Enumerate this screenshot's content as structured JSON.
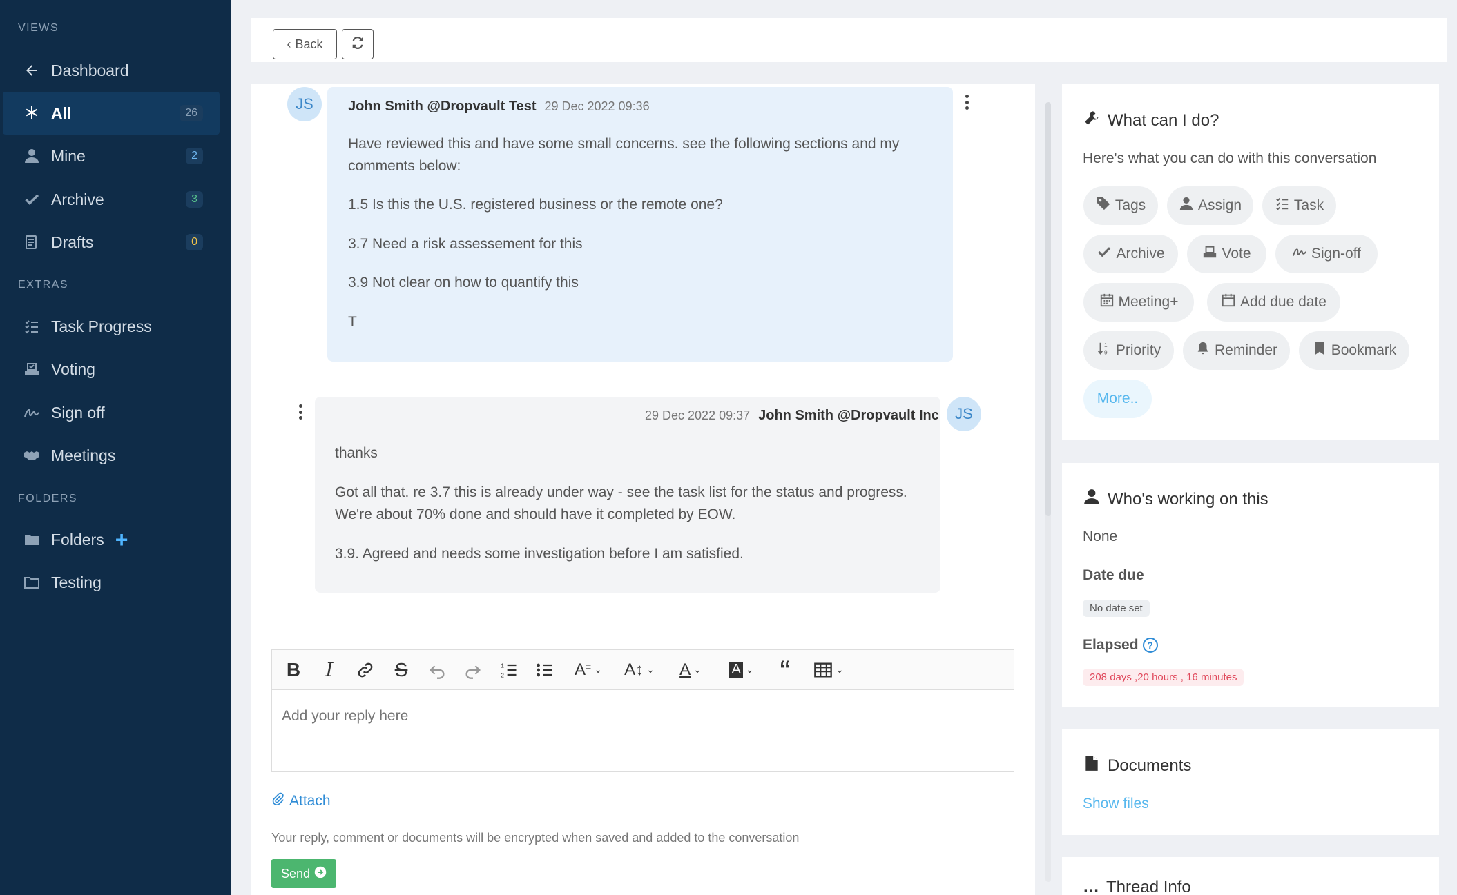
{
  "sidebar": {
    "views_heading": "VIEWS",
    "extras_heading": "EXTRAS",
    "folders_heading": "FOLDERS",
    "views": [
      {
        "label": "Dashboard",
        "icon": "arrow-left-icon"
      },
      {
        "label": "All",
        "icon": "asterisk-icon",
        "count": "26"
      },
      {
        "label": "Mine",
        "icon": "user-icon",
        "count": "2"
      },
      {
        "label": "Archive",
        "icon": "check-icon",
        "count": "3"
      },
      {
        "label": "Drafts",
        "icon": "drafts-icon",
        "count": "0"
      }
    ],
    "extras": [
      {
        "label": "Task Progress",
        "icon": "tasks-icon"
      },
      {
        "label": "Voting",
        "icon": "vote-icon"
      },
      {
        "label": "Sign off",
        "icon": "signature-icon"
      },
      {
        "label": "Meetings",
        "icon": "handshake-icon"
      }
    ],
    "folders": [
      {
        "label": "Folders",
        "icon": "folder-icon"
      },
      {
        "label": "Testing",
        "icon": "folder-outline-icon"
      }
    ]
  },
  "topbar": {
    "back_label": "Back"
  },
  "messages": [
    {
      "avatar": "JS",
      "author": "John Smith @Dropvault Test",
      "time": "29 Dec 2022 09:36",
      "paragraphs": [
        "Have reviewed this and have some small concerns. see the following sections and my",
        "comments below:",
        "1.5 Is this the U.S. registered business or the remote one?",
        "3.7 Need a risk assessement for this",
        "3.9 Not clear on how to quantify this",
        "T"
      ]
    },
    {
      "avatar": "JS",
      "author": "John Smith @Dropvault Inc",
      "time": "29 Dec 2022 09:37",
      "paragraphs": [
        "thanks",
        "Got all that. re 3.7 this is already under way - see the task list for the status and progress.",
        "We're about 70% done and should have it completed by EOW.",
        "3.9. Agreed and needs some investigation before I am satisfied."
      ]
    }
  ],
  "editor": {
    "placeholder": "Add your reply here",
    "attach_label": "Attach",
    "note": "Your reply, comment or documents will be encrypted when saved and added to the conversation",
    "send_label": "Send"
  },
  "actions_card": {
    "title": "What can I do?",
    "subtitle": "Here's what you can do with this conversation",
    "actions": [
      "Tags",
      "Assign",
      "Task",
      "Archive",
      "Vote",
      "Sign-off",
      "Meeting+",
      "Add due date",
      "Priority",
      "Reminder",
      "Bookmark",
      "More.."
    ]
  },
  "working_card": {
    "title": "Who's working on this",
    "assignee": "None",
    "date_due_label": "Date due",
    "date_due_value": "No date set",
    "elapsed_label": "Elapsed",
    "elapsed_value": "208 days ,20 hours , 16 minutes"
  },
  "documents_card": {
    "title": "Documents",
    "show_files": "Show files"
  },
  "thread_card": {
    "title": "Thread Info"
  },
  "colors": {
    "sidebar_bg": "#0f2c48",
    "active_item_bg": "#123a5f",
    "accent_blue": "#2f8cd6",
    "send_green": "#4cb66f",
    "elapsed_red": "#e0485b"
  }
}
